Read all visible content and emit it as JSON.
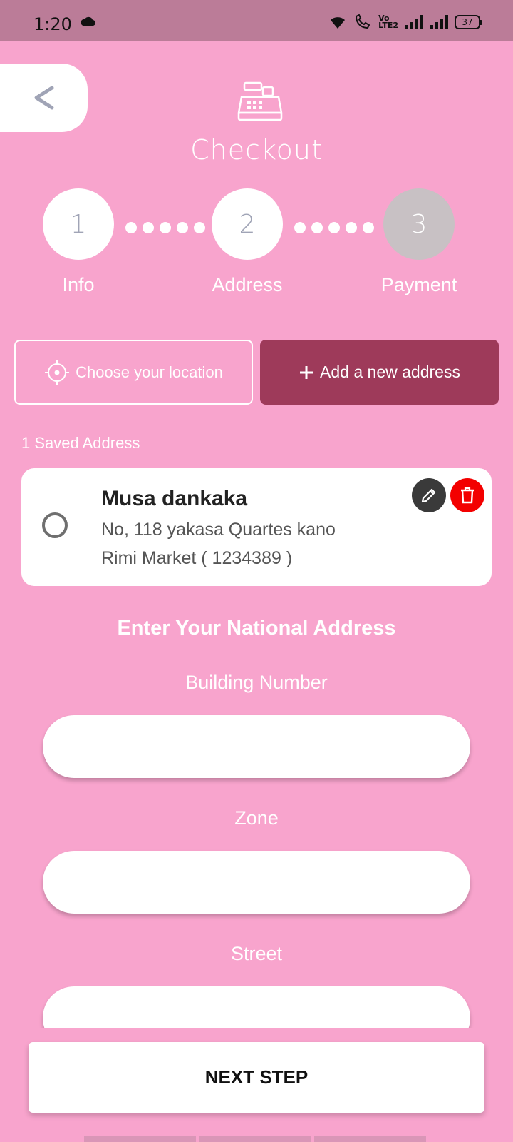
{
  "status_bar": {
    "time": "1:20",
    "battery": "37",
    "network_label": "Vo\nLTE2"
  },
  "header": {
    "title": "Checkout",
    "back_symbol": "<"
  },
  "steps": [
    {
      "number": "1",
      "label": "Info",
      "state": "done"
    },
    {
      "number": "2",
      "label": "Address",
      "state": "current"
    },
    {
      "number": "3",
      "label": "Payment",
      "state": "upcoming"
    }
  ],
  "actions": {
    "choose_location_label": "Choose your location",
    "add_address_label": "Add a new address"
  },
  "saved": {
    "count_label": "1 Saved Address",
    "addresses": [
      {
        "name": "Musa dankaka",
        "line1": "No, 118 yakasa Quartes kano",
        "line2": "Rimi Market ( 1234389 )",
        "selected": false
      }
    ]
  },
  "national_address": {
    "heading": "Enter Your National Address",
    "fields": [
      {
        "label": "Building Number",
        "value": ""
      },
      {
        "label": "Zone",
        "value": ""
      },
      {
        "label": "Street",
        "value": ""
      }
    ]
  },
  "footer": {
    "next_label": "NEXT STEP"
  },
  "colors": {
    "background": "#f8a4cd",
    "status_bar": "#bb7c98",
    "accent": "#9e3a5a",
    "delete": "#f30000",
    "edit": "#3a3a3a",
    "inactive_step": "#c8c1c4"
  }
}
